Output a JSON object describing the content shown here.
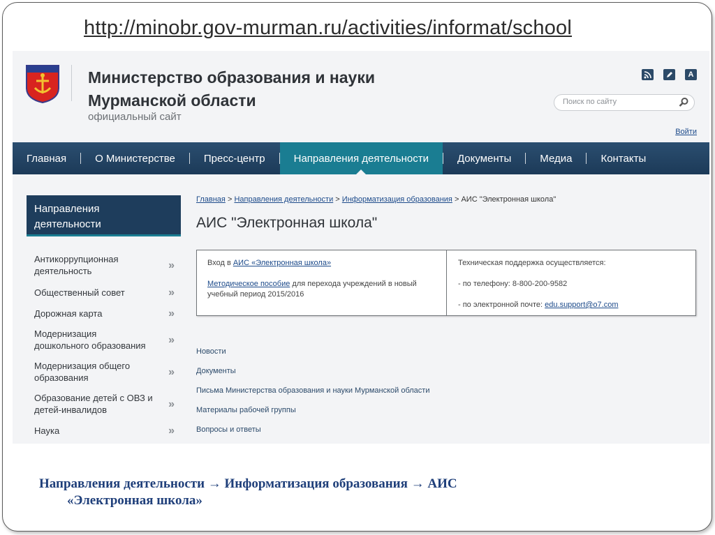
{
  "slide": {
    "url": "http://minobr.gov-murman.ru/activities/informat/school",
    "caption_line1": "Направления деятельности → Информатизация образования → АИС",
    "caption_line2": "«Электронная школа»"
  },
  "header": {
    "title_line1": "Министерство образования и науки",
    "title_line2": "Мурманской области",
    "subtitle": "официальный сайт",
    "icons": [
      "rss-icon",
      "edit-icon",
      "font-size-icon"
    ],
    "font_icon_label": "A",
    "search_placeholder": "Поиск по сайту",
    "login": "Войти"
  },
  "nav": {
    "items": [
      "Главная",
      "О Министерстве",
      "Пресс-центр",
      "Направления деятельности",
      "Документы",
      "Медиа",
      "Контакты"
    ],
    "active": "Направления деятельности"
  },
  "sidebar": {
    "heading_line1": "Направления",
    "heading_line2": "деятельности",
    "items": [
      {
        "line1": "Антикоррупционная",
        "line2": "деятельность"
      },
      {
        "line1": "Общественный совет",
        "line2": ""
      },
      {
        "line1": "Дорожная карта",
        "line2": ""
      },
      {
        "line1": "Модернизация",
        "line2": "дошкольного образования"
      },
      {
        "line1": "Модернизация общего",
        "line2": "образования"
      },
      {
        "line1": "Образование детей с ОВЗ и",
        "line2": "детей-инвалидов"
      },
      {
        "line1": "Наука",
        "line2": ""
      }
    ],
    "arrow": "»"
  },
  "breadcrumb": {
    "items": [
      "Главная",
      "Направления деятельности",
      "Информатизация образования"
    ],
    "current": "АИС \"Электронная школа\"",
    "separator": ">"
  },
  "page_title": "АИС \"Электронная школа\"",
  "info": {
    "login_prefix": "Вход в ",
    "login_link": "АИС «Электронная школа»",
    "manual_link": "Методическое пособие",
    "manual_rest_line1": " для перехода учреждений в новый",
    "manual_rest_line2": "учебный период 2015/2016",
    "support_title": "Техническая поддержка осуществляется:",
    "phone_line": "- по телефону: 8-800-200-9582",
    "email_prefix": "- по электронной почте: ",
    "email": "edu.support@o7.com"
  },
  "links": [
    "Новости",
    "Документы",
    "Письма Министерства образования и науки Мурманской области",
    "Материалы рабочей группы",
    "Вопросы и ответы"
  ],
  "colors": {
    "nav_bg": "#1c3a58",
    "nav_active": "#1a7d92",
    "sidebar_heading": "#1e3d5c",
    "link": "#1c4a8a",
    "caption": "#1f3f7a"
  }
}
